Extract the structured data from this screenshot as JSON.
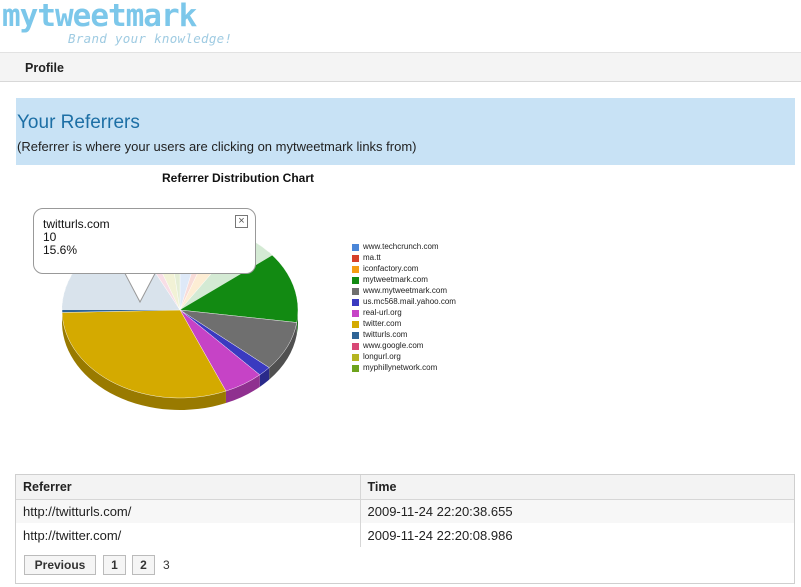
{
  "header": {
    "logo": "mytweetmark",
    "tagline": "Brand your knowledge!"
  },
  "nav": {
    "profile": "Profile"
  },
  "banner": {
    "title": "Your Referrers",
    "subtitle": "(Referrer is where your users are clicking on mytweetmark links from)"
  },
  "chart_data": {
    "type": "pie",
    "title": "Referrer Distribution Chart",
    "series": [
      {
        "label": "www.techcrunch.com",
        "value": 2,
        "color": "#4a86d8"
      },
      {
        "label": "ma.tt",
        "value": 1,
        "color": "#d6402a"
      },
      {
        "label": "iconfactory.com",
        "value": 2,
        "color": "#f49c12"
      },
      {
        "label": "mytweetmark.com",
        "value": 10,
        "color": "#128a12"
      },
      {
        "label": "www.mytweetmark.com",
        "value": 5,
        "color": "#6f6f6f"
      },
      {
        "label": "us.mc568.mail.yahoo.com",
        "value": 1,
        "color": "#3a3ac0"
      },
      {
        "label": "real-url.org",
        "value": 3,
        "color": "#c643c6"
      },
      {
        "label": "twitter.com",
        "value": 17,
        "color": "#d4aa00"
      },
      {
        "label": "twitturls.com",
        "value": 10,
        "color": "#2e6496"
      },
      {
        "label": "www.google.com",
        "value": 1,
        "color": "#d84876"
      },
      {
        "label": "longurl.org",
        "value": 2,
        "color": "#b5b520"
      },
      {
        "label": "myphillynetwork.com",
        "value": 1,
        "color": "#6ea31c"
      }
    ],
    "tooltip": {
      "label": "twitturls.com",
      "value": "10",
      "percent": "15.6%"
    }
  },
  "table": {
    "headers": [
      "Referrer",
      "Time"
    ],
    "rows": [
      [
        "http://twitturls.com/",
        "2009-11-24 22:20:38.655"
      ],
      [
        "http://twitter.com/",
        "2009-11-24 22:20:08.986"
      ]
    ]
  },
  "pager": {
    "previous": "Previous",
    "pages": [
      "1",
      "2",
      "3"
    ]
  }
}
